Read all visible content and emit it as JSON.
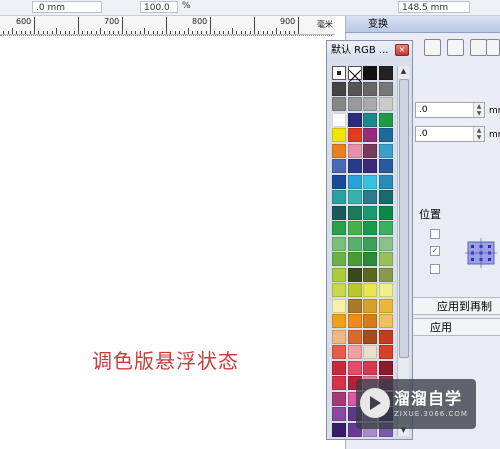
{
  "toolbar": {
    "field1": ".0 mm",
    "field2": "100.0",
    "pct": "%",
    "field3": "148.5 mm"
  },
  "ruler": {
    "labels": [
      "600",
      "700",
      "800",
      "900"
    ],
    "unit": "毫米"
  },
  "docker": {
    "title": "变换",
    "field_x": ".0",
    "field_y": ".0",
    "unit_x": "mm",
    "unit_y": "mm",
    "position_label": "位置",
    "apply_copy": "应用到再制",
    "apply": "应用"
  },
  "palette": {
    "title": "默认 RGB ...",
    "close": "×",
    "colors": [
      "no-fill",
      "no-color",
      "#111111",
      "#222222",
      "#444444",
      "#555555",
      "#666666",
      "#777777",
      "#888888",
      "#999999",
      "#aaaaaa",
      "#cccccc",
      "#ffffff",
      "#2c2c7a",
      "#1a8a8a",
      "#1f9a48",
      "#f2e600",
      "#e63a1f",
      "#9a2a7a",
      "#1f6a9a",
      "#e8801f",
      "#e890a8",
      "#7a3a5a",
      "#3aa0c8",
      "#4a6ab8",
      "#2a3a8a",
      "#3a2a7a",
      "#2a5a9a",
      "#1a4a9a",
      "#2aa0d8",
      "#3ac0e0",
      "#2a8ab8",
      "#2aa0a0",
      "#3ab0b0",
      "#2a7a8a",
      "#1a6a6a",
      "#1a5a5a",
      "#1a7a5a",
      "#1a9a6a",
      "#0a8a4a",
      "#2aa04a",
      "#4ab04a",
      "#1a9a4a",
      "#3ab060",
      "#7ac07a",
      "#5ab06a",
      "#3aa05a",
      "#8ac08a",
      "#6ab04a",
      "#4a9a3a",
      "#2a8a3a",
      "#9ac05a",
      "#aacc3a",
      "#3a4a1a",
      "#5a6a1a",
      "#8a9a4a",
      "#c8d84a",
      "#b8c82a",
      "#e8e84a",
      "#f0f08a",
      "#f8f0a8",
      "#a87a2a",
      "#d8a02a",
      "#e8b83a",
      "#f0a01a",
      "#f08a1a",
      "#d87a1a",
      "#f0c05a",
      "#f0b880",
      "#d86a2a",
      "#a84a1a",
      "#c83a1a",
      "#e85a4a",
      "#f0a0a0",
      "#e8e0c8",
      "#d8402a",
      "#c82a3a",
      "#e84a6a",
      "#d83a4a",
      "#8a1a2a",
      "#d8304a",
      "#b8203a",
      "#e880a0",
      "#8a2a4a",
      "#a83a7a",
      "#d85aa0",
      "#c84a8a",
      "#6a2a6a",
      "#8a4aa0",
      "#5a3a8a",
      "#b880c8",
      "#3a1a5a",
      "#3a1a6a",
      "#6a3a9a",
      "#aa8ac8",
      "#7a5aa8"
    ]
  },
  "caption": "调色版悬浮状态",
  "watermark": {
    "text": "溜溜自学",
    "sub": "ZIXUE.3066.COM"
  }
}
